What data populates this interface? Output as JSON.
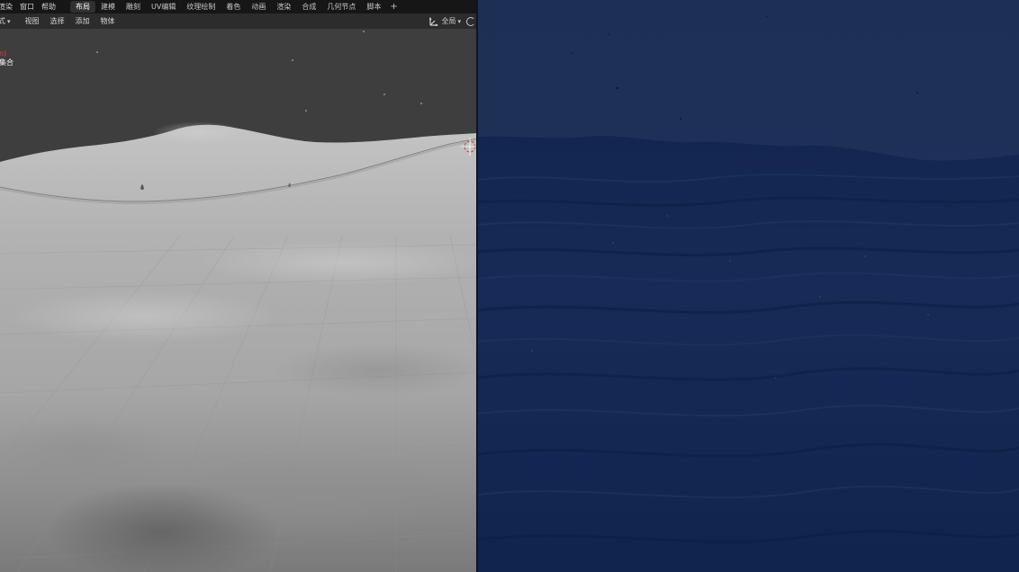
{
  "topbar": {
    "menu": [
      "渲染",
      "窗口",
      "帮助"
    ],
    "tabs": [
      {
        "label": "布局",
        "active": true
      },
      {
        "label": "建模",
        "active": false
      },
      {
        "label": "雕刻",
        "active": false
      },
      {
        "label": "UV编辑",
        "active": false
      },
      {
        "label": "纹理绘制",
        "active": false
      },
      {
        "label": "着色",
        "active": false
      },
      {
        "label": "动画",
        "active": false
      },
      {
        "label": "渲染",
        "active": false
      },
      {
        "label": "合成",
        "active": false
      },
      {
        "label": "几何节点",
        "active": false
      },
      {
        "label": "脚本",
        "active": false
      }
    ],
    "add_tab_label": "+"
  },
  "viewport_header": {
    "mode_label": "式",
    "menu": [
      "视图",
      "选择",
      "添加",
      "物体"
    ],
    "transform_orientation": "全局",
    "transform_icon": "transform-orientation-icon",
    "snap_icon": "snap-icon"
  },
  "viewport": {
    "overlay_red": "n)",
    "collection": "集合"
  },
  "colors": {
    "topbar_bg": "#161616",
    "header_bg": "#2c2c2c",
    "viewport_bg": "#3e3e3e",
    "terrain": "#a9a9a9",
    "ocean_sky": "#1f3158",
    "ocean_water": "#152a52"
  }
}
